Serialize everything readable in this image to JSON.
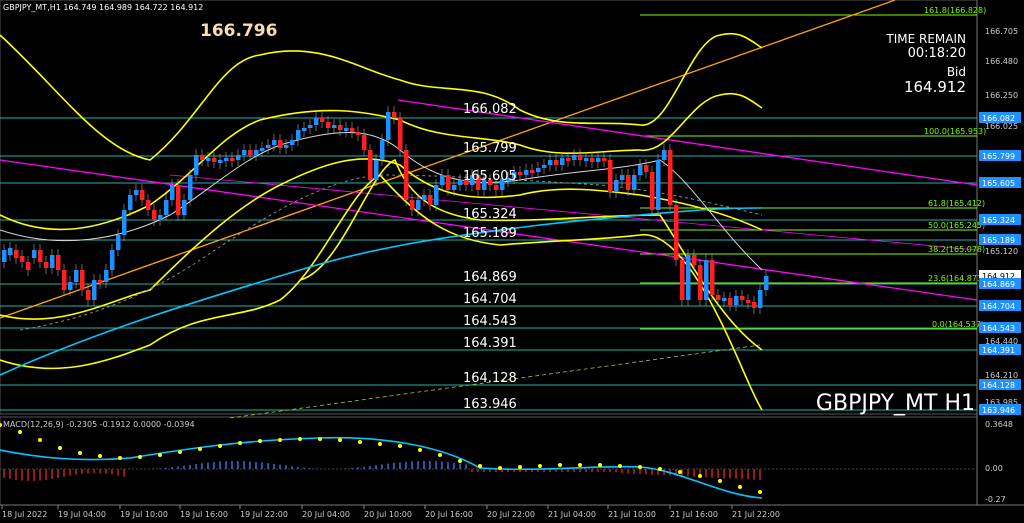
{
  "header": {
    "symbol_info": "GBPJPY_MT,H1  164.749 164.989 164.722 164.912",
    "big_price": "166.796"
  },
  "timer": {
    "label": "TIME REMAIN",
    "value": "00:18:20",
    "bid_label": "Bid",
    "bid_value": "164.912"
  },
  "watermark": "GBPJPY_MT H1",
  "levels": [
    "166.082",
    "165.799",
    "165.605",
    "165.324",
    "165.189",
    "164.869",
    "164.704",
    "164.543",
    "164.391",
    "164.128",
    "163.946"
  ],
  "fib": [
    "161.8(166.828)",
    "100.0(165.953)",
    "61.8(165.412)",
    "50.0(165.245)",
    "38.2(165.078)",
    "23.6(164.871)",
    "0.0(164.537)"
  ],
  "price_axis": {
    "ticks": [
      "166.705",
      "166.480",
      "166.250",
      "166.025",
      "165.120",
      "164.440",
      "164.210",
      "163.985"
    ],
    "tag_labels": [
      "166.082",
      "165.799",
      "165.605",
      "165.324",
      "165.189",
      "164.912",
      "164.869",
      "164.704",
      "164.543",
      "164.391",
      "164.128",
      "163.946"
    ]
  },
  "macd": {
    "label": "MACD(12,26,9) -0.2305 -0.1912 0.0000 -0.0394",
    "ticks": [
      "0.3648",
      "0.00",
      "-0.27"
    ]
  },
  "time_axis": [
    "18 Jul 2022",
    "19 Jul 04:00",
    "19 Jul 10:00",
    "19 Jul 16:00",
    "19 Jul 22:00",
    "20 Jul 04:00",
    "20 Jul 10:00",
    "20 Jul 16:00",
    "20 Jul 22:00",
    "21 Jul 04:00",
    "21 Jul 10:00",
    "21 Jul 16:00",
    "21 Jul 22:00"
  ],
  "colors": {
    "up": "#1e90ff",
    "down": "#ff2020",
    "band": "#ffff00",
    "ma": "#00c8ff",
    "trend": "#ff00ff",
    "fib": "#7cfc00",
    "level": "#20b2aa"
  }
}
